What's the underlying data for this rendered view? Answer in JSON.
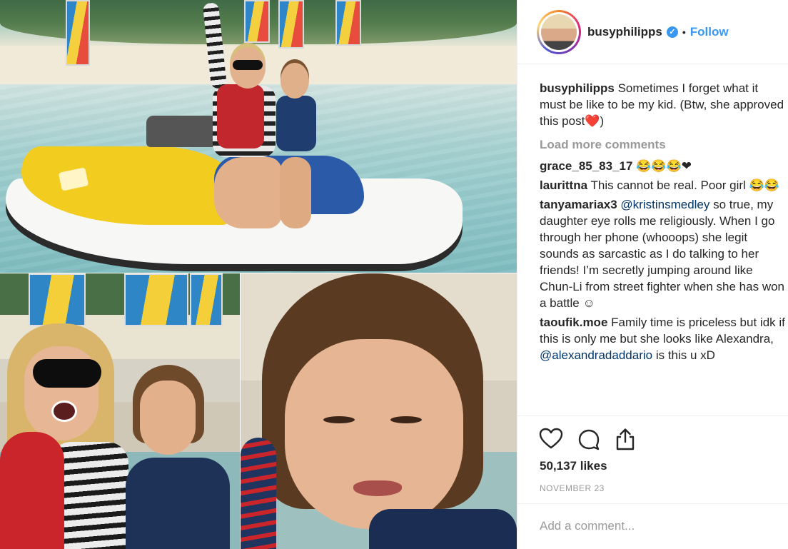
{
  "post": {
    "username": "busyphilipps",
    "verified": true,
    "follow_label": "Follow",
    "separator": "•"
  },
  "caption": {
    "user": "busyphilipps",
    "text": "Sometimes I forget what it must be like to be my kid. (Btw, she approved this post❤️)"
  },
  "load_more": "Load more comments",
  "comments": [
    {
      "user": "grace_85_83_17",
      "text": "😂😂😂❤"
    },
    {
      "user": "laurittna",
      "text": "This cannot be real. Poor girl 😂😂"
    },
    {
      "user": "tanyamariax3",
      "mention": "@kristinsmedley",
      "text": "so true, my daughter eye rolls me religiously. When I go through her phone (whooops) she legit sounds as sarcastic as I do talking to her friends! I’m secretly jumping around like Chun-Li from street fighter when she has won a battle ☺"
    },
    {
      "user": "taoufik.moe",
      "text": "Family time is priceless but idk if this is only me but she looks like Alexandra,",
      "mention": "@alexandradaddario",
      "tail": "is this u xD"
    }
  ],
  "actions": {
    "icons": [
      "heart-icon",
      "comment-icon",
      "share-icon"
    ]
  },
  "likes": "50,137 likes",
  "date": "NOVEMBER 23",
  "add_comment_placeholder": "Add a comment...",
  "colors": {
    "link_blue": "#3897f0",
    "mention_blue": "#003569",
    "muted_gray": "#999999",
    "text": "#262626"
  }
}
